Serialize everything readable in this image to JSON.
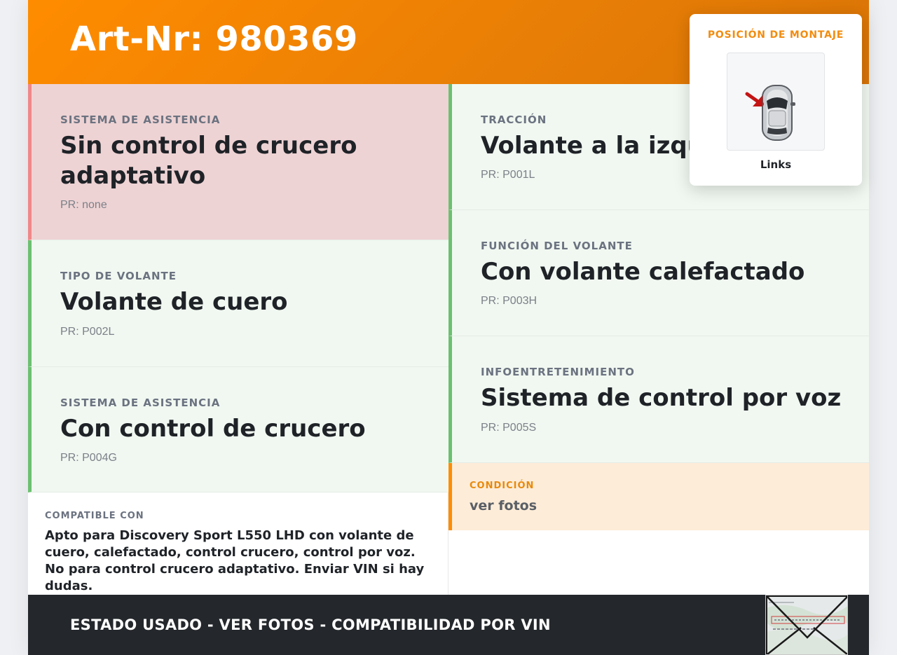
{
  "header": {
    "title": "Art-Nr: 980369"
  },
  "mount_popup": {
    "title": "POSICIÓN DE MONTAJE",
    "caption": "Links"
  },
  "cells": [
    {
      "label": "SISTEMA DE ASISTENCIA",
      "value": "Sin control de crucero adaptativo",
      "pr": "PR: none",
      "status": "negative"
    },
    {
      "label": "TRACCIÓN",
      "value": "Volante a la izquierda",
      "pr": "PR: P001L",
      "status": "positive"
    },
    {
      "label": "TIPO DE VOLANTE",
      "value": "Volante de cuero",
      "pr": "PR: P002L",
      "status": "positive"
    },
    {
      "label": "FUNCIÓN DEL VOLANTE",
      "value": "Con volante calefactado",
      "pr": "PR: P003H",
      "status": "positive"
    },
    {
      "label": "SISTEMA DE ASISTENCIA",
      "value": "Con control de crucero",
      "pr": "PR: P004G",
      "status": "positive"
    },
    {
      "label": "INFOENTRETENIMIENTO",
      "value": "Sistema de control por voz",
      "pr": "PR: P005S",
      "status": "positive"
    }
  ],
  "compat": {
    "label": "COMPATIBLE CON",
    "text": "Apto para Discovery Sport L550 LHD con volante de cuero, calefactado, control crucero, control por voz. No para control crucero adaptativo. Enviar VIN si hay dudas."
  },
  "condition": {
    "label": "CONDICIÓN",
    "text": "ver fotos"
  },
  "footer": {
    "text": "ESTADO USADO - VER FOTOS - COMPATIBILIDAD POR VIN"
  },
  "colors": {
    "accent": "#ff8c00",
    "positive": "#6cc070",
    "negative": "#f08888",
    "footer_bg": "#24272b"
  },
  "icons": {
    "mount": "car-top-view-icon",
    "arrow": "red-arrow-icon",
    "doc": "vehicle-document-thumbnail"
  }
}
